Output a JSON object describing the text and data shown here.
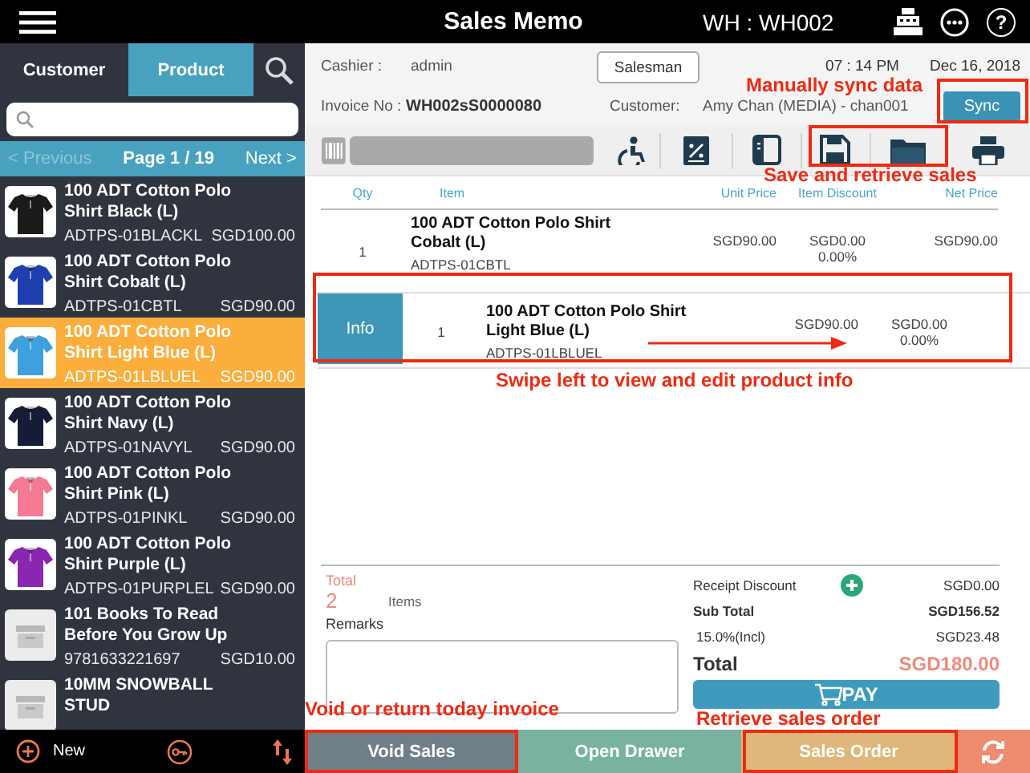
{
  "top_bar": {
    "title": "Sales Memo",
    "warehouse": "WH : WH002",
    "help": "?"
  },
  "sidebar": {
    "tabs": [
      {
        "label": "Customer",
        "selected": false
      },
      {
        "label": "Product",
        "selected": true
      }
    ],
    "pager": {
      "previous": "< Previous",
      "previous_disabled": true,
      "page": "Page 1 / 19",
      "next": "Next >"
    },
    "products": [
      {
        "name": "100 ADT Cotton Polo Shirt Black (L)",
        "code": "ADTPS-01BLACKL",
        "price": "SGD100.00",
        "kind": "shirt",
        "color": "#1a1a1a",
        "selected": false
      },
      {
        "name": "100 ADT Cotton Polo Shirt Cobalt (L)",
        "code": "ADTPS-01CBTL",
        "price": "SGD90.00",
        "kind": "shirt",
        "color": "#1f3fb0",
        "selected": false
      },
      {
        "name": "100 ADT Cotton Polo Shirt Light Blue (L)",
        "code": "ADTPS-01LBLUEL",
        "price": "SGD90.00",
        "kind": "shirt",
        "color": "#3ea0dc",
        "selected": true
      },
      {
        "name": "100 ADT Cotton Polo Shirt Navy (L)",
        "code": "ADTPS-01NAVYL",
        "price": "SGD90.00",
        "kind": "shirt",
        "color": "#141c36",
        "selected": false
      },
      {
        "name": "100 ADT Cotton Polo Shirt Pink (L)",
        "code": "ADTPS-01PINKL",
        "price": "SGD90.00",
        "kind": "shirt",
        "color": "#f47a94",
        "selected": false
      },
      {
        "name": "100 ADT Cotton Polo Shirt Purple (L)",
        "code": "ADTPS-01PURPLEL",
        "price": "SGD90.00",
        "kind": "shirt",
        "color": "#8a27b0",
        "selected": false
      },
      {
        "name": "101 Books To Read Before You Grow Up",
        "code": "9781633221697",
        "price": "SGD10.00",
        "kind": "placeholder",
        "selected": false
      },
      {
        "name": "10MM SNOWBALL STUD",
        "kind": "placeholder",
        "selected": false
      }
    ],
    "new_label": "New"
  },
  "header": {
    "cashier_label": "Cashier :",
    "cashier": "admin",
    "salesman_button": "Salesman",
    "time": "07 : 14 PM",
    "date": "Dec 16, 2018",
    "invoice_label": "Invoice No :",
    "invoice": "WH002sS0000080",
    "customer_label": "Customer:",
    "customer": "Amy Chan (MEDIA) - chan001",
    "sync_button": "Sync"
  },
  "table": {
    "columns": [
      "Qty",
      "Item",
      "Unit Price",
      "Item Discount",
      "Net Price"
    ],
    "rows": [
      {
        "qty": "1",
        "name": "100 ADT Cotton Polo Shirt Cobalt (L)",
        "code": "ADTPS-01CBTL",
        "unit_price": "SGD90.00",
        "discount": "SGD0.00",
        "discount_pct": "0.00%",
        "net_price": "SGD90.00",
        "swiped": false
      },
      {
        "qty": "1",
        "name": "100 ADT Cotton Polo Shirt Light Blue (L)",
        "code": "ADTPS-01LBLUEL",
        "unit_price": "SGD90.00",
        "discount": "SGD0.00",
        "discount_pct": "0.00%",
        "swiped": true,
        "info_button": "Info"
      }
    ]
  },
  "summary": {
    "total_label": "Total",
    "total_count": "2",
    "items_label": "Items",
    "remarks_label": "Remarks",
    "lines": [
      {
        "label": "Receipt Discount",
        "value": "SGD0.00",
        "kind": "discount"
      },
      {
        "label": "Sub Total",
        "value": "SGD156.52",
        "kind": "subtotal"
      },
      {
        "label": "15.0%(Incl)",
        "value": "SGD23.48",
        "kind": "tax"
      },
      {
        "label": "Total",
        "value": "SGD180.00",
        "kind": "total"
      }
    ],
    "pay_button": "PAY"
  },
  "action_bar": [
    {
      "label": "Void Sales",
      "kind": "text",
      "color": "#6f7f88"
    },
    {
      "label": "Open Drawer",
      "kind": "text",
      "color": "#7ab2a2"
    },
    {
      "label": "Sales Order",
      "kind": "text",
      "color": "#dfb77b"
    },
    {
      "kind": "refresh",
      "color": "#ef8b6f"
    }
  ],
  "annotations": [
    {
      "kind": "sync",
      "text": "Manually sync data"
    },
    {
      "kind": "save",
      "text": "Save and retrieve sales"
    },
    {
      "kind": "swipe",
      "text": "Swipe left to view and edit product info"
    },
    {
      "kind": "void",
      "text": "Void or return today invoice"
    },
    {
      "kind": "order",
      "text": "Retrieve sales order"
    }
  ]
}
